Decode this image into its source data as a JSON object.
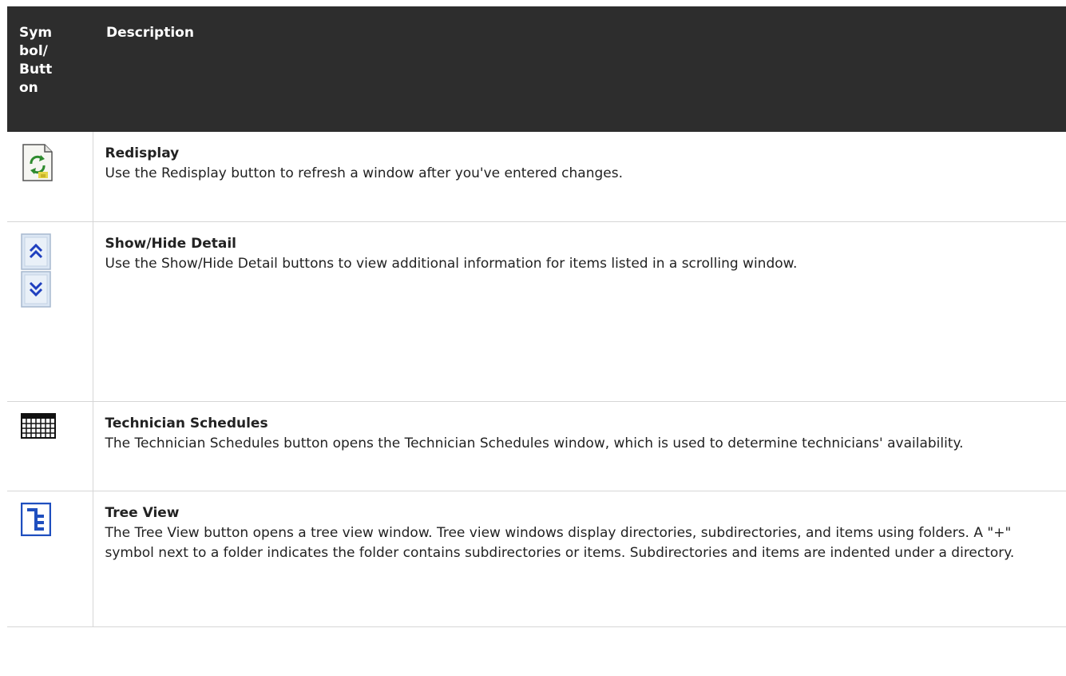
{
  "table": {
    "headers": {
      "symbol": "Symbol/Button",
      "description": "Description"
    },
    "rows": [
      {
        "icon": "redisplay-icon",
        "title": "Redisplay",
        "text": "Use the Redisplay button to refresh a window after you've entered changes."
      },
      {
        "icon": "show-hide-detail-icon",
        "title": "Show/Hide Detail",
        "text": "Use the Show/Hide Detail buttons to view additional information for items listed in a scrolling window."
      },
      {
        "icon": "technician-schedules-icon",
        "title": "Technician Schedules",
        "text": "The Technician Schedules button opens the Technician Schedules window, which is used to determine technicians' availability."
      },
      {
        "icon": "tree-view-icon",
        "title": "Tree View",
        "text": "The Tree View button opens a tree view window. Tree view windows display directories, subdirectories, and items using folders. A \"+\" symbol next to a folder indicates the folder contains subdirectories or items. Subdirectories and items are indented under a directory."
      }
    ]
  }
}
